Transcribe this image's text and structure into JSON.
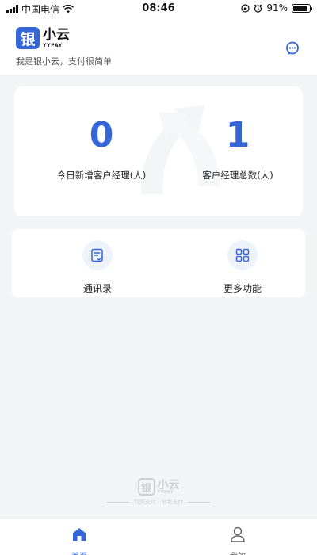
{
  "status_bar": {
    "carrier": "中国电信",
    "time": "08:46",
    "battery": "91%",
    "battery_level": 0.91
  },
  "header": {
    "logo_char": "银",
    "app_name": "小云",
    "app_name_en": "YYPAY",
    "slogan": "我是银小云，支付很简单",
    "message_icon": "chat-bubble-icon"
  },
  "stats": [
    {
      "value": "0",
      "label": "今日新增客户经理(人)"
    },
    {
      "value": "1",
      "label": "客户经理总数(人)"
    }
  ],
  "functions": [
    {
      "label": "通讯录",
      "icon": "contacts-icon"
    },
    {
      "label": "更多功能",
      "icon": "grid-icon"
    }
  ],
  "footer_brand": {
    "logo_char": "银",
    "name": "小云",
    "name_en": "YYPAY",
    "tagline": "引领支付 · 创新支付"
  },
  "tabs": [
    {
      "label": "首页",
      "icon": "home-icon",
      "active": true
    },
    {
      "label": "我的",
      "icon": "user-icon",
      "active": false
    }
  ],
  "colors": {
    "accent": "#3566d8",
    "background": "#f3f4f6",
    "card": "#ffffff"
  }
}
